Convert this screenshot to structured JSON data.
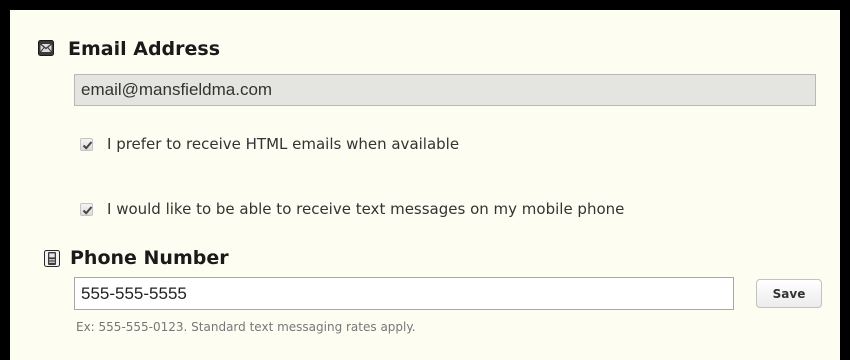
{
  "email_section": {
    "icon": "envelope-icon",
    "title": "Email Address",
    "value": "email@mansfieldma.com",
    "options": [
      {
        "label": "I prefer to receive HTML emails when available",
        "checked": true
      },
      {
        "label": "I would like to be able to receive text messages on my mobile phone",
        "checked": true
      }
    ]
  },
  "phone_section": {
    "icon": "mobile-phone-icon",
    "title": "Phone Number",
    "value": "555-555-5555",
    "save_label": "Save",
    "hint": "Ex: 555-555-0123. Standard text messaging rates apply."
  }
}
